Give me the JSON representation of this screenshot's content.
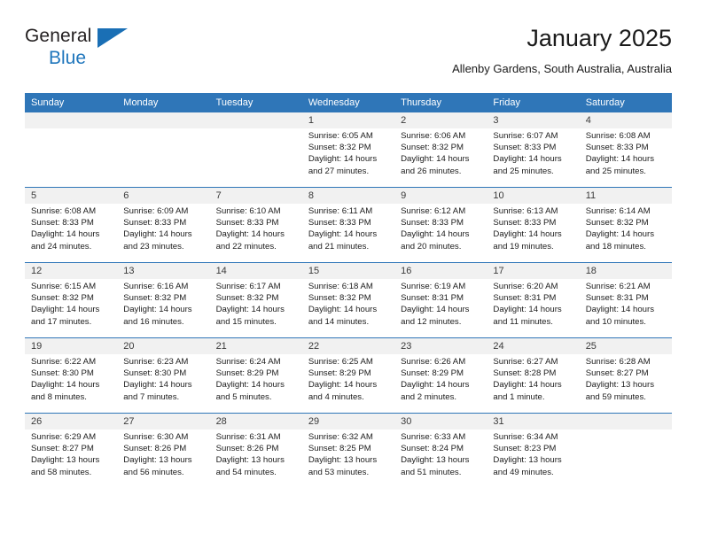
{
  "brand": {
    "word1": "General",
    "word2": "Blue",
    "flag_icon": "triangle-flag-icon",
    "accent_color": "#1a6fb5"
  },
  "header": {
    "title": "January 2025",
    "subtitle": "Allenby Gardens, South Australia, Australia"
  },
  "calendar": {
    "header_bg": "#2f76b8",
    "daynum_bg": "#f1f1f1",
    "weekday_headers": [
      "Sunday",
      "Monday",
      "Tuesday",
      "Wednesday",
      "Thursday",
      "Friday",
      "Saturday"
    ],
    "labels": {
      "sunrise": "Sunrise:",
      "sunset": "Sunset:",
      "daylight": "Daylight:"
    },
    "weeks": [
      [
        {
          "day": "",
          "empty": true
        },
        {
          "day": "",
          "empty": true
        },
        {
          "day": "",
          "empty": true
        },
        {
          "day": "1",
          "sunrise": "Sunrise: 6:05 AM",
          "sunset": "Sunset: 8:32 PM",
          "daylight1": "Daylight: 14 hours",
          "daylight2": "and 27 minutes."
        },
        {
          "day": "2",
          "sunrise": "Sunrise: 6:06 AM",
          "sunset": "Sunset: 8:32 PM",
          "daylight1": "Daylight: 14 hours",
          "daylight2": "and 26 minutes."
        },
        {
          "day": "3",
          "sunrise": "Sunrise: 6:07 AM",
          "sunset": "Sunset: 8:33 PM",
          "daylight1": "Daylight: 14 hours",
          "daylight2": "and 25 minutes."
        },
        {
          "day": "4",
          "sunrise": "Sunrise: 6:08 AM",
          "sunset": "Sunset: 8:33 PM",
          "daylight1": "Daylight: 14 hours",
          "daylight2": "and 25 minutes."
        }
      ],
      [
        {
          "day": "5",
          "sunrise": "Sunrise: 6:08 AM",
          "sunset": "Sunset: 8:33 PM",
          "daylight1": "Daylight: 14 hours",
          "daylight2": "and 24 minutes."
        },
        {
          "day": "6",
          "sunrise": "Sunrise: 6:09 AM",
          "sunset": "Sunset: 8:33 PM",
          "daylight1": "Daylight: 14 hours",
          "daylight2": "and 23 minutes."
        },
        {
          "day": "7",
          "sunrise": "Sunrise: 6:10 AM",
          "sunset": "Sunset: 8:33 PM",
          "daylight1": "Daylight: 14 hours",
          "daylight2": "and 22 minutes."
        },
        {
          "day": "8",
          "sunrise": "Sunrise: 6:11 AM",
          "sunset": "Sunset: 8:33 PM",
          "daylight1": "Daylight: 14 hours",
          "daylight2": "and 21 minutes."
        },
        {
          "day": "9",
          "sunrise": "Sunrise: 6:12 AM",
          "sunset": "Sunset: 8:33 PM",
          "daylight1": "Daylight: 14 hours",
          "daylight2": "and 20 minutes."
        },
        {
          "day": "10",
          "sunrise": "Sunrise: 6:13 AM",
          "sunset": "Sunset: 8:33 PM",
          "daylight1": "Daylight: 14 hours",
          "daylight2": "and 19 minutes."
        },
        {
          "day": "11",
          "sunrise": "Sunrise: 6:14 AM",
          "sunset": "Sunset: 8:32 PM",
          "daylight1": "Daylight: 14 hours",
          "daylight2": "and 18 minutes."
        }
      ],
      [
        {
          "day": "12",
          "sunrise": "Sunrise: 6:15 AM",
          "sunset": "Sunset: 8:32 PM",
          "daylight1": "Daylight: 14 hours",
          "daylight2": "and 17 minutes."
        },
        {
          "day": "13",
          "sunrise": "Sunrise: 6:16 AM",
          "sunset": "Sunset: 8:32 PM",
          "daylight1": "Daylight: 14 hours",
          "daylight2": "and 16 minutes."
        },
        {
          "day": "14",
          "sunrise": "Sunrise: 6:17 AM",
          "sunset": "Sunset: 8:32 PM",
          "daylight1": "Daylight: 14 hours",
          "daylight2": "and 15 minutes."
        },
        {
          "day": "15",
          "sunrise": "Sunrise: 6:18 AM",
          "sunset": "Sunset: 8:32 PM",
          "daylight1": "Daylight: 14 hours",
          "daylight2": "and 14 minutes."
        },
        {
          "day": "16",
          "sunrise": "Sunrise: 6:19 AM",
          "sunset": "Sunset: 8:31 PM",
          "daylight1": "Daylight: 14 hours",
          "daylight2": "and 12 minutes."
        },
        {
          "day": "17",
          "sunrise": "Sunrise: 6:20 AM",
          "sunset": "Sunset: 8:31 PM",
          "daylight1": "Daylight: 14 hours",
          "daylight2": "and 11 minutes."
        },
        {
          "day": "18",
          "sunrise": "Sunrise: 6:21 AM",
          "sunset": "Sunset: 8:31 PM",
          "daylight1": "Daylight: 14 hours",
          "daylight2": "and 10 minutes."
        }
      ],
      [
        {
          "day": "19",
          "sunrise": "Sunrise: 6:22 AM",
          "sunset": "Sunset: 8:30 PM",
          "daylight1": "Daylight: 14 hours",
          "daylight2": "and 8 minutes."
        },
        {
          "day": "20",
          "sunrise": "Sunrise: 6:23 AM",
          "sunset": "Sunset: 8:30 PM",
          "daylight1": "Daylight: 14 hours",
          "daylight2": "and 7 minutes."
        },
        {
          "day": "21",
          "sunrise": "Sunrise: 6:24 AM",
          "sunset": "Sunset: 8:29 PM",
          "daylight1": "Daylight: 14 hours",
          "daylight2": "and 5 minutes."
        },
        {
          "day": "22",
          "sunrise": "Sunrise: 6:25 AM",
          "sunset": "Sunset: 8:29 PM",
          "daylight1": "Daylight: 14 hours",
          "daylight2": "and 4 minutes."
        },
        {
          "day": "23",
          "sunrise": "Sunrise: 6:26 AM",
          "sunset": "Sunset: 8:29 PM",
          "daylight1": "Daylight: 14 hours",
          "daylight2": "and 2 minutes."
        },
        {
          "day": "24",
          "sunrise": "Sunrise: 6:27 AM",
          "sunset": "Sunset: 8:28 PM",
          "daylight1": "Daylight: 14 hours",
          "daylight2": "and 1 minute."
        },
        {
          "day": "25",
          "sunrise": "Sunrise: 6:28 AM",
          "sunset": "Sunset: 8:27 PM",
          "daylight1": "Daylight: 13 hours",
          "daylight2": "and 59 minutes."
        }
      ],
      [
        {
          "day": "26",
          "sunrise": "Sunrise: 6:29 AM",
          "sunset": "Sunset: 8:27 PM",
          "daylight1": "Daylight: 13 hours",
          "daylight2": "and 58 minutes."
        },
        {
          "day": "27",
          "sunrise": "Sunrise: 6:30 AM",
          "sunset": "Sunset: 8:26 PM",
          "daylight1": "Daylight: 13 hours",
          "daylight2": "and 56 minutes."
        },
        {
          "day": "28",
          "sunrise": "Sunrise: 6:31 AM",
          "sunset": "Sunset: 8:26 PM",
          "daylight1": "Daylight: 13 hours",
          "daylight2": "and 54 minutes."
        },
        {
          "day": "29",
          "sunrise": "Sunrise: 6:32 AM",
          "sunset": "Sunset: 8:25 PM",
          "daylight1": "Daylight: 13 hours",
          "daylight2": "and 53 minutes."
        },
        {
          "day": "30",
          "sunrise": "Sunrise: 6:33 AM",
          "sunset": "Sunset: 8:24 PM",
          "daylight1": "Daylight: 13 hours",
          "daylight2": "and 51 minutes."
        },
        {
          "day": "31",
          "sunrise": "Sunrise: 6:34 AM",
          "sunset": "Sunset: 8:23 PM",
          "daylight1": "Daylight: 13 hours",
          "daylight2": "and 49 minutes."
        },
        {
          "day": "",
          "empty": true
        }
      ]
    ]
  }
}
